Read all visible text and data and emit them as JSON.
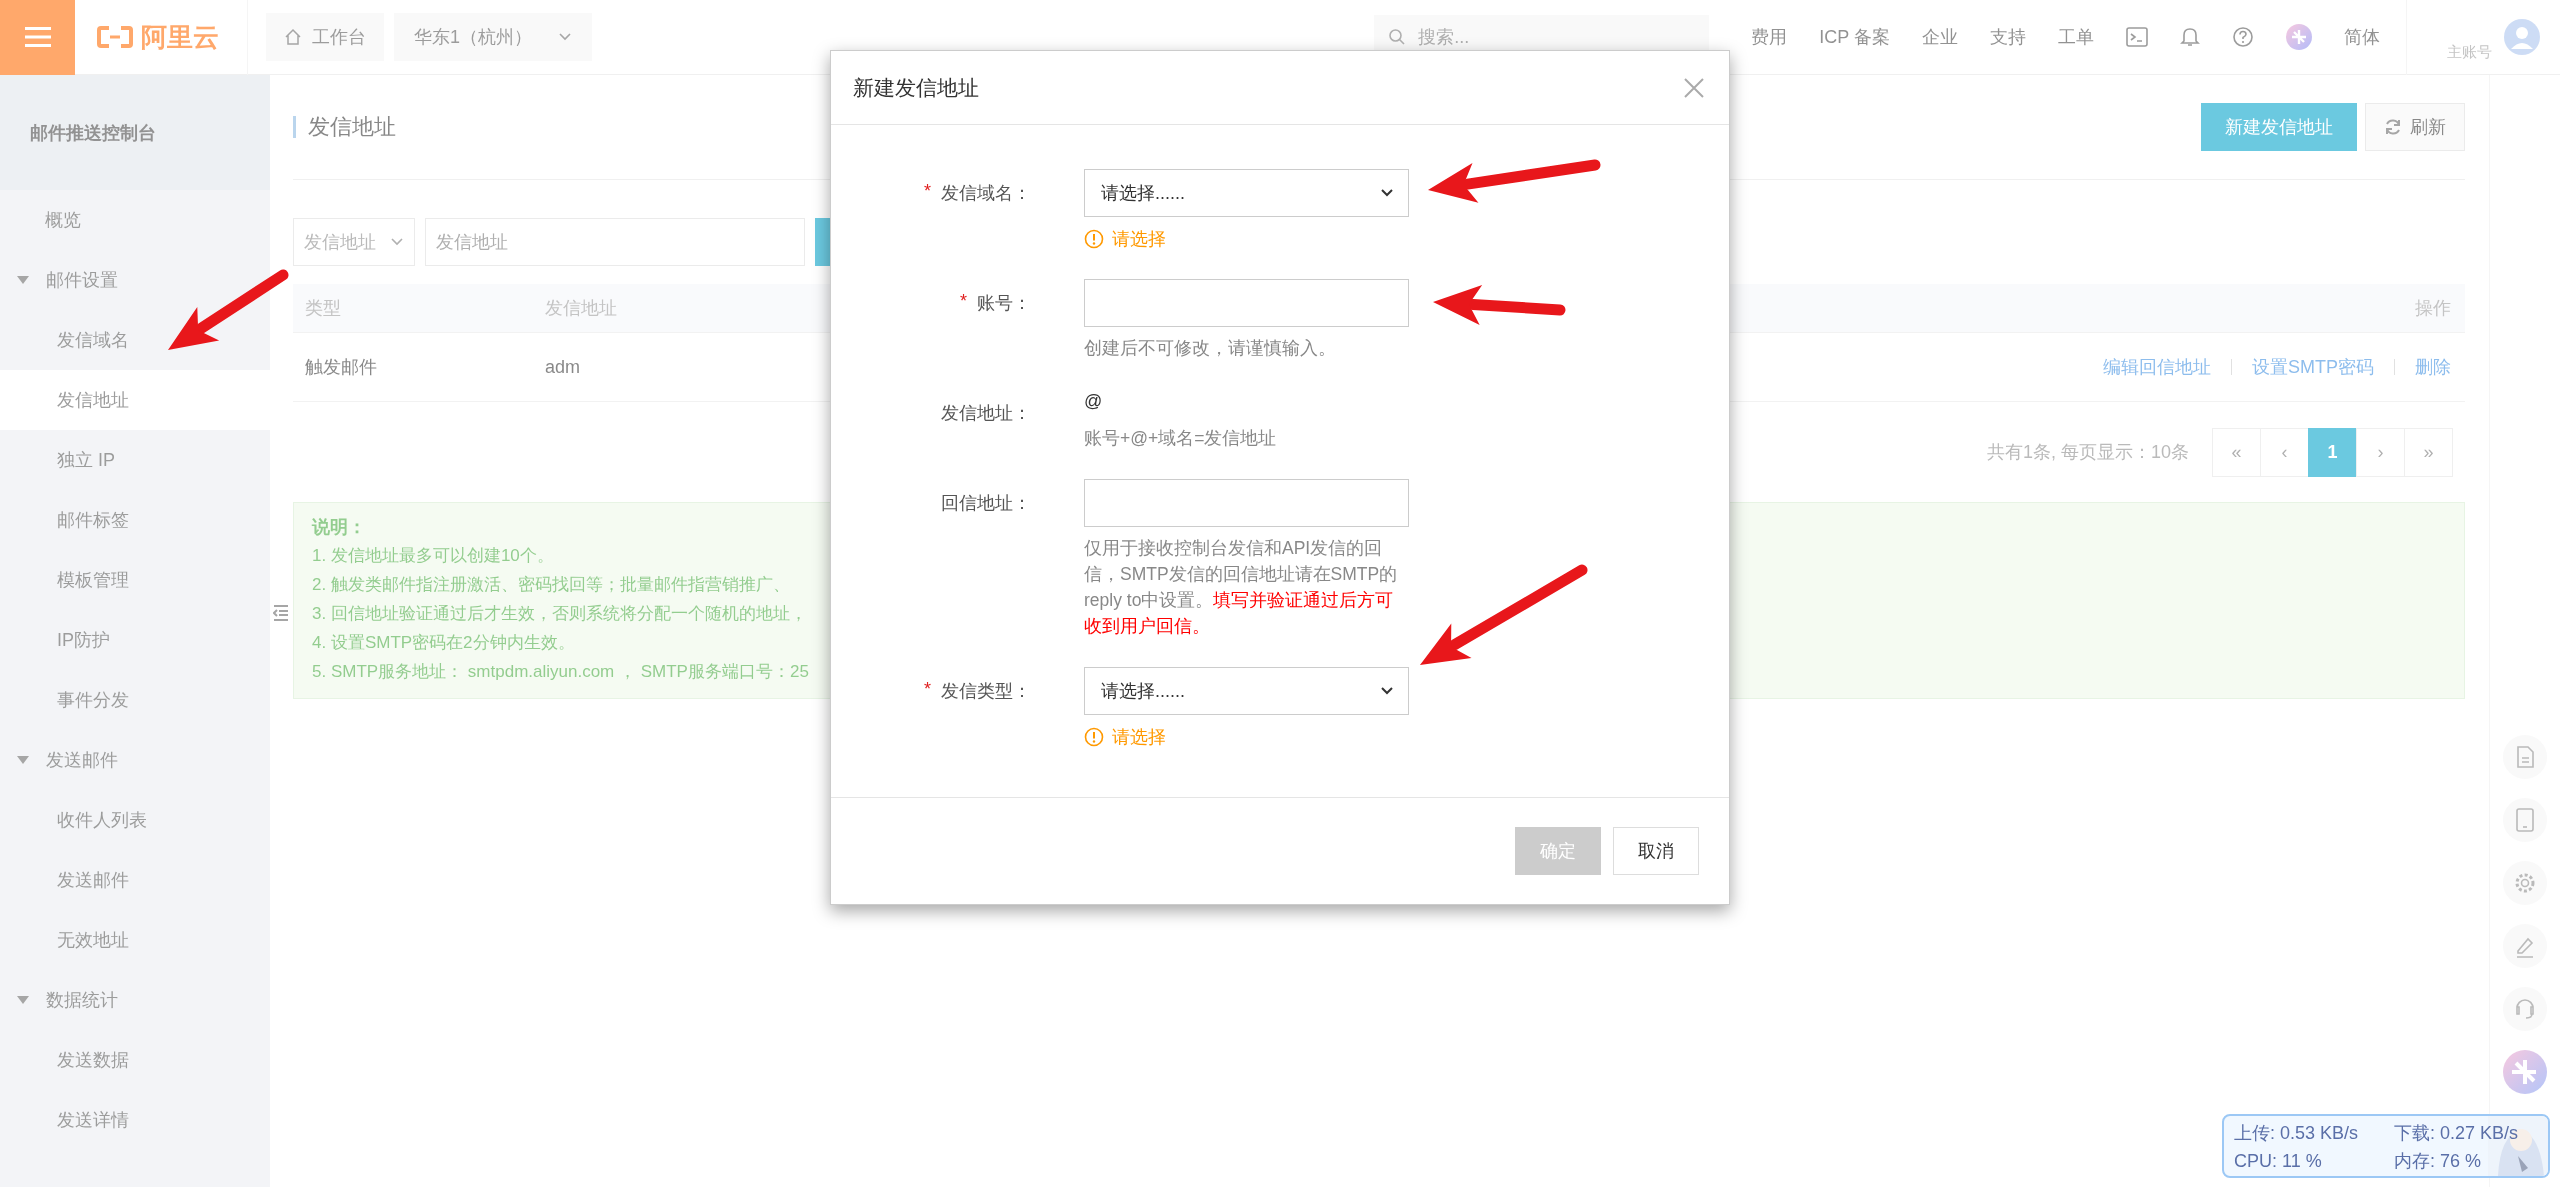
{
  "top_bar": {
    "brand": "阿里云",
    "workbench": "工作台",
    "region": "华东1（杭州）",
    "search": {
      "placeholder": "搜索..."
    },
    "links": [
      "费用",
      "ICP 备案",
      "企业",
      "支持",
      "工单"
    ],
    "language": "简体",
    "account": "主账号"
  },
  "sidebar": {
    "title": "邮件推送控制台",
    "items": [
      {
        "kind": "link",
        "label": "概览",
        "selected": false
      },
      {
        "kind": "group",
        "label": "邮件设置",
        "expanded": true,
        "selected": false,
        "children": [
          {
            "kind": "link",
            "label": "发信域名",
            "selected": false
          },
          {
            "kind": "link",
            "label": "发信地址",
            "selected": true
          },
          {
            "kind": "link",
            "label": "独立 IP",
            "selected": false
          },
          {
            "kind": "link",
            "label": "邮件标签",
            "selected": false
          },
          {
            "kind": "link",
            "label": "模板管理",
            "selected": false
          },
          {
            "kind": "link",
            "label": "IP防护",
            "selected": false
          },
          {
            "kind": "link",
            "label": "事件分发",
            "selected": false
          }
        ]
      },
      {
        "kind": "group",
        "label": "发送邮件",
        "expanded": true,
        "selected": false,
        "children": [
          {
            "kind": "link",
            "label": "收件人列表",
            "selected": false
          },
          {
            "kind": "link",
            "label": "发送邮件",
            "selected": false
          },
          {
            "kind": "link",
            "label": "无效地址",
            "selected": false
          }
        ]
      },
      {
        "kind": "group",
        "label": "数据统计",
        "expanded": true,
        "selected": false,
        "children": [
          {
            "kind": "link",
            "label": "发送数据",
            "selected": false
          },
          {
            "kind": "link",
            "label": "发送详情",
            "selected": false
          }
        ]
      }
    ]
  },
  "page": {
    "title": "发信地址",
    "buttons": [
      {
        "kind": "primary",
        "label": "新建发信地址"
      },
      {
        "kind": "refresh",
        "label": "刷新"
      }
    ],
    "filter": {
      "select": "发信地址",
      "placeholder": "发信地址"
    },
    "table": {
      "columns": [
        "类型",
        "发信地址",
        "操作"
      ],
      "rows": [
        {
          "cells": [
            "触发邮件",
            "adm"
          ],
          "actions": [
            "编辑回信地址",
            "设置SMTP密码",
            "删除"
          ]
        }
      ]
    },
    "pagination": {
      "summary": "共有1条, 每页显示：10条",
      "pages": [
        {
          "label": "«",
          "selected": false
        },
        {
          "label": "‹",
          "selected": false
        },
        {
          "label": "1",
          "selected": true
        },
        {
          "label": "›",
          "selected": false
        },
        {
          "label": "»",
          "selected": false
        }
      ]
    },
    "notes": {
      "title": "说明：",
      "lines": [
        "1. 发信地址最多可以创建10个。",
        "2. 触发类邮件指注册激活、密码找回等；批量邮件指营销推广、",
        "3. 回信地址验证通过后才生效，否则系统将分配一个随机的地址，",
        "4. 设置SMTP密码在2分钟内生效。",
        "5. SMTP服务地址： smtpdm.aliyun.com ， SMTP服务端口号：25"
      ]
    }
  },
  "dialog": {
    "title": "新建发信地址",
    "fields": [
      {
        "kind": "select",
        "label": "发信域名：",
        "mark": "*",
        "value": "请选择......",
        "error": "请选择"
      },
      {
        "kind": "input",
        "label": "账号：",
        "mark": "*",
        "help": "创建后不可修改，请谨慎输入。"
      },
      {
        "kind": "static",
        "label": "发信地址：",
        "value": "@",
        "help": "账号+@+域名=发信地址"
      },
      {
        "kind": "input",
        "label": "回信地址：",
        "help": "仅用于接收控制台发信和API发信的回信，SMTP发信的回信地址请在SMTP的reply to中设置。",
        "warning": "填写并验证通过后方可收到用户回信。"
      },
      {
        "kind": "select",
        "label": "发信类型：",
        "mark": "*",
        "value": "请选择......",
        "error": "请选择"
      }
    ],
    "buttons": [
      {
        "kind": "primary",
        "label": "确定",
        "disabled": true
      },
      {
        "kind": "default",
        "label": "取消",
        "disabled": false
      }
    ]
  },
  "monitor": {
    "stats": [
      "上传: 0.53 KB/s",
      "下载: 0.27 KB/s",
      "CPU: 11 %",
      "内存: 76 %"
    ]
  }
}
